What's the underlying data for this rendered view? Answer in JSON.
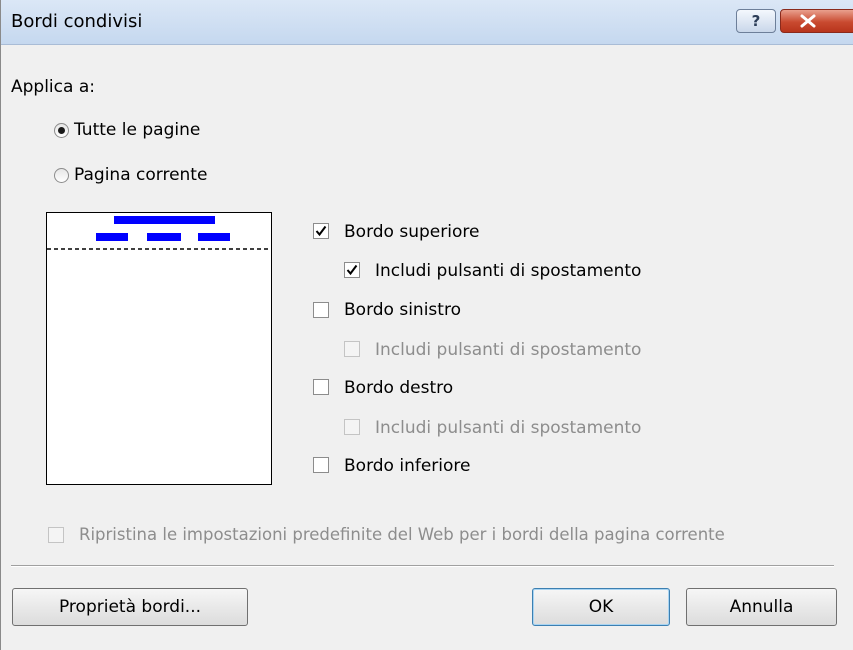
{
  "window": {
    "title": "Bordi condivisi",
    "help_label": "?",
    "help_icon": "question-icon",
    "close_icon": "close-x-icon"
  },
  "apply_to": {
    "label": "Applica a:",
    "options": [
      {
        "label": "Tutte le pagine",
        "selected": true
      },
      {
        "label": "Pagina corrente",
        "selected": false
      }
    ]
  },
  "preview": {
    "accent_color": "#0000ff",
    "shows": "top-border-with-nav-buttons"
  },
  "borders": {
    "top": {
      "label": "Bordo superiore",
      "checked": true
    },
    "top_nav": {
      "label": "Includi pulsanti di spostamento",
      "checked": true,
      "enabled": true
    },
    "left": {
      "label": "Bordo sinistro",
      "checked": false
    },
    "left_nav": {
      "label": "Includi pulsanti di spostamento",
      "checked": false,
      "enabled": false
    },
    "right": {
      "label": "Bordo destro",
      "checked": false
    },
    "right_nav": {
      "label": "Includi pulsanti di spostamento",
      "checked": false,
      "enabled": false
    },
    "bottom": {
      "label": "Bordo inferiore",
      "checked": false
    }
  },
  "reset": {
    "label": "Ripristina le impostazioni predefinite del Web per i bordi della pagina corrente",
    "checked": false,
    "enabled": false
  },
  "buttons": {
    "properties": "Proprietà bordi...",
    "ok": "OK",
    "cancel": "Annulla"
  }
}
